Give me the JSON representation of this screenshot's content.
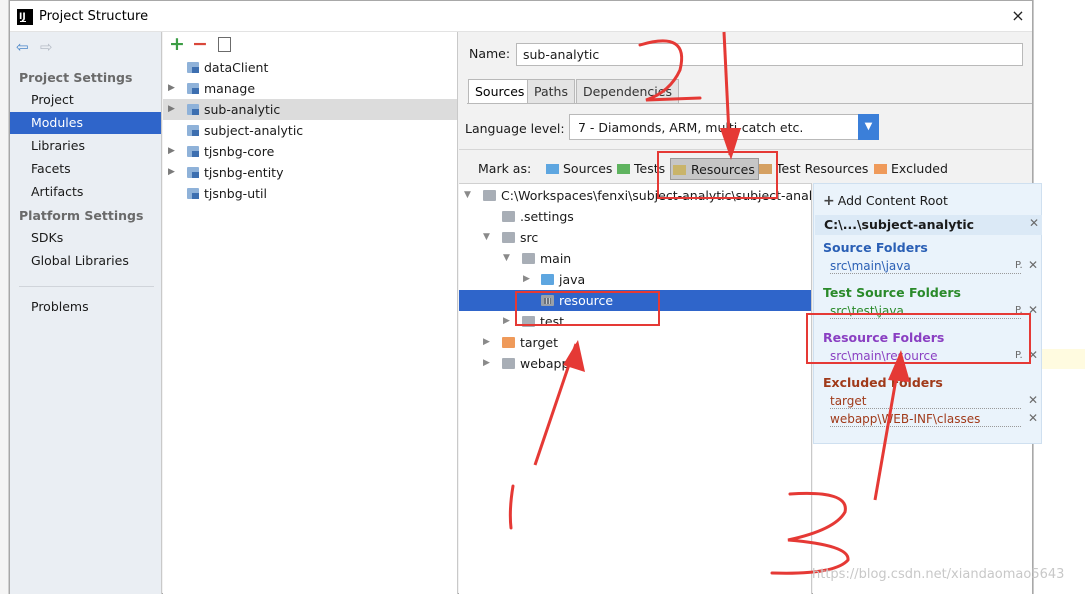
{
  "window": {
    "title": "Project Structure",
    "close_icon": "×"
  },
  "nav": {
    "project_settings_header": "Project Settings",
    "project_settings": [
      "Project",
      "Modules",
      "Libraries",
      "Facets",
      "Artifacts"
    ],
    "platform_settings_header": "Platform Settings",
    "platform_settings": [
      "SDKs",
      "Global Libraries"
    ],
    "problems": "Problems",
    "selected": "Modules"
  },
  "modules": {
    "items": [
      "dataClient",
      "manage",
      "sub-analytic",
      "subject-analytic",
      "tjsnbg-core",
      "tjsnbg-entity",
      "tjsnbg-util"
    ],
    "expandable": [
      false,
      true,
      true,
      false,
      true,
      true,
      false
    ],
    "selected": "sub-analytic"
  },
  "module_settings": {
    "name_label": "Name:",
    "name_value": "sub-analytic",
    "tabs": [
      "Sources",
      "Paths",
      "Dependencies"
    ],
    "active_tab": "Sources",
    "language_level_label": "Language level:",
    "language_level_value": "7 - Diamonds, ARM, multi-catch etc.",
    "mark_as_label": "Mark as:",
    "mark_as": [
      {
        "label": "Sources",
        "color": "#5ea6e0"
      },
      {
        "label": "Tests",
        "color": "#5fb35f"
      },
      {
        "label": "Resources",
        "color": "#c9b46a"
      },
      {
        "label": "Test Resources",
        "color": "#d5a062"
      },
      {
        "label": "Excluded",
        "color": "#ef9a5a"
      }
    ],
    "mark_as_pressed": "Resources"
  },
  "tree": {
    "root": "C:\\Workspaces\\fenxi\\subject-analytic\\subject-analytic",
    "settings": ".settings",
    "src": "src",
    "main": "main",
    "java": "java",
    "resource": "resource",
    "test": "test",
    "target": "target",
    "webapp": "webapp"
  },
  "content_root": {
    "add_label": "Add Content Root",
    "root_path": "C:\\...\\subject-analytic",
    "sections": [
      {
        "title": "Source Folders",
        "color": "#2a5fb5",
        "paths": [
          "src\\main\\java"
        ]
      },
      {
        "title": "Test Source Folders",
        "color": "#2a8a2a",
        "paths": [
          "src\\test\\java"
        ]
      },
      {
        "title": "Resource Folders",
        "color": "#8a3fc2",
        "paths": [
          "src\\main\\resource"
        ]
      },
      {
        "title": "Excluded Folders",
        "color": "#a03a1a",
        "paths": [
          "target",
          "webapp\\WEB-INF\\classes"
        ]
      }
    ]
  },
  "annotations": {
    "numbers": [
      "1",
      "2",
      "3"
    ]
  },
  "watermark": "https://blog.csdn.net/xiandaomao5643"
}
